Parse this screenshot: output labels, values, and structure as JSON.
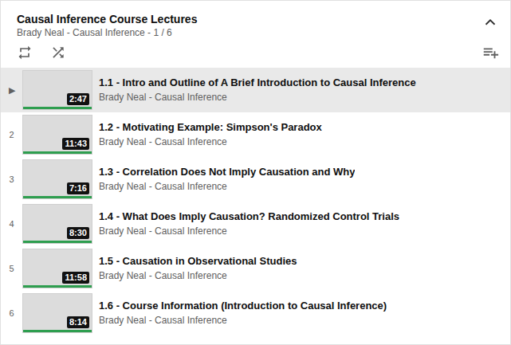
{
  "playlist": {
    "title": "Causal Inference Course Lectures",
    "subtitle": "Brady Neal - Causal Inference - 1 / 6"
  },
  "items": [
    {
      "index": "▶",
      "title": "1.1 - Intro and Outline of A Brief Introduction to Causal Inference",
      "channel": "Brady Neal - Causal Inference",
      "duration": "2:47",
      "selected": true,
      "level": 1
    },
    {
      "index": "2",
      "title": "1.2 - Motivating Example: Simpson's Paradox",
      "channel": "Brady Neal - Causal Inference",
      "duration": "11:43",
      "selected": false,
      "level": 1
    },
    {
      "index": "3",
      "title": "1.3 - Correlation Does Not Imply Causation and Why",
      "channel": "Brady Neal - Causal Inference",
      "duration": "7:16",
      "selected": false,
      "level": 1
    },
    {
      "index": "4",
      "title": "1.4 - What Does Imply Causation? Randomized Control Trials",
      "channel": "Brady Neal - Causal Inference",
      "duration": "8:30",
      "selected": false,
      "level": 1
    },
    {
      "index": "5",
      "title": "1.5 - Causation in Observational Studies",
      "channel": "Brady Neal - Causal Inference",
      "duration": "11:58",
      "selected": false,
      "level": 1
    },
    {
      "index": "6",
      "title": "1.6 - Course Information (Introduction to Causal Inference)",
      "channel": "Brady Neal - Causal Inference",
      "duration": "8:14",
      "selected": false,
      "level": 1
    }
  ]
}
